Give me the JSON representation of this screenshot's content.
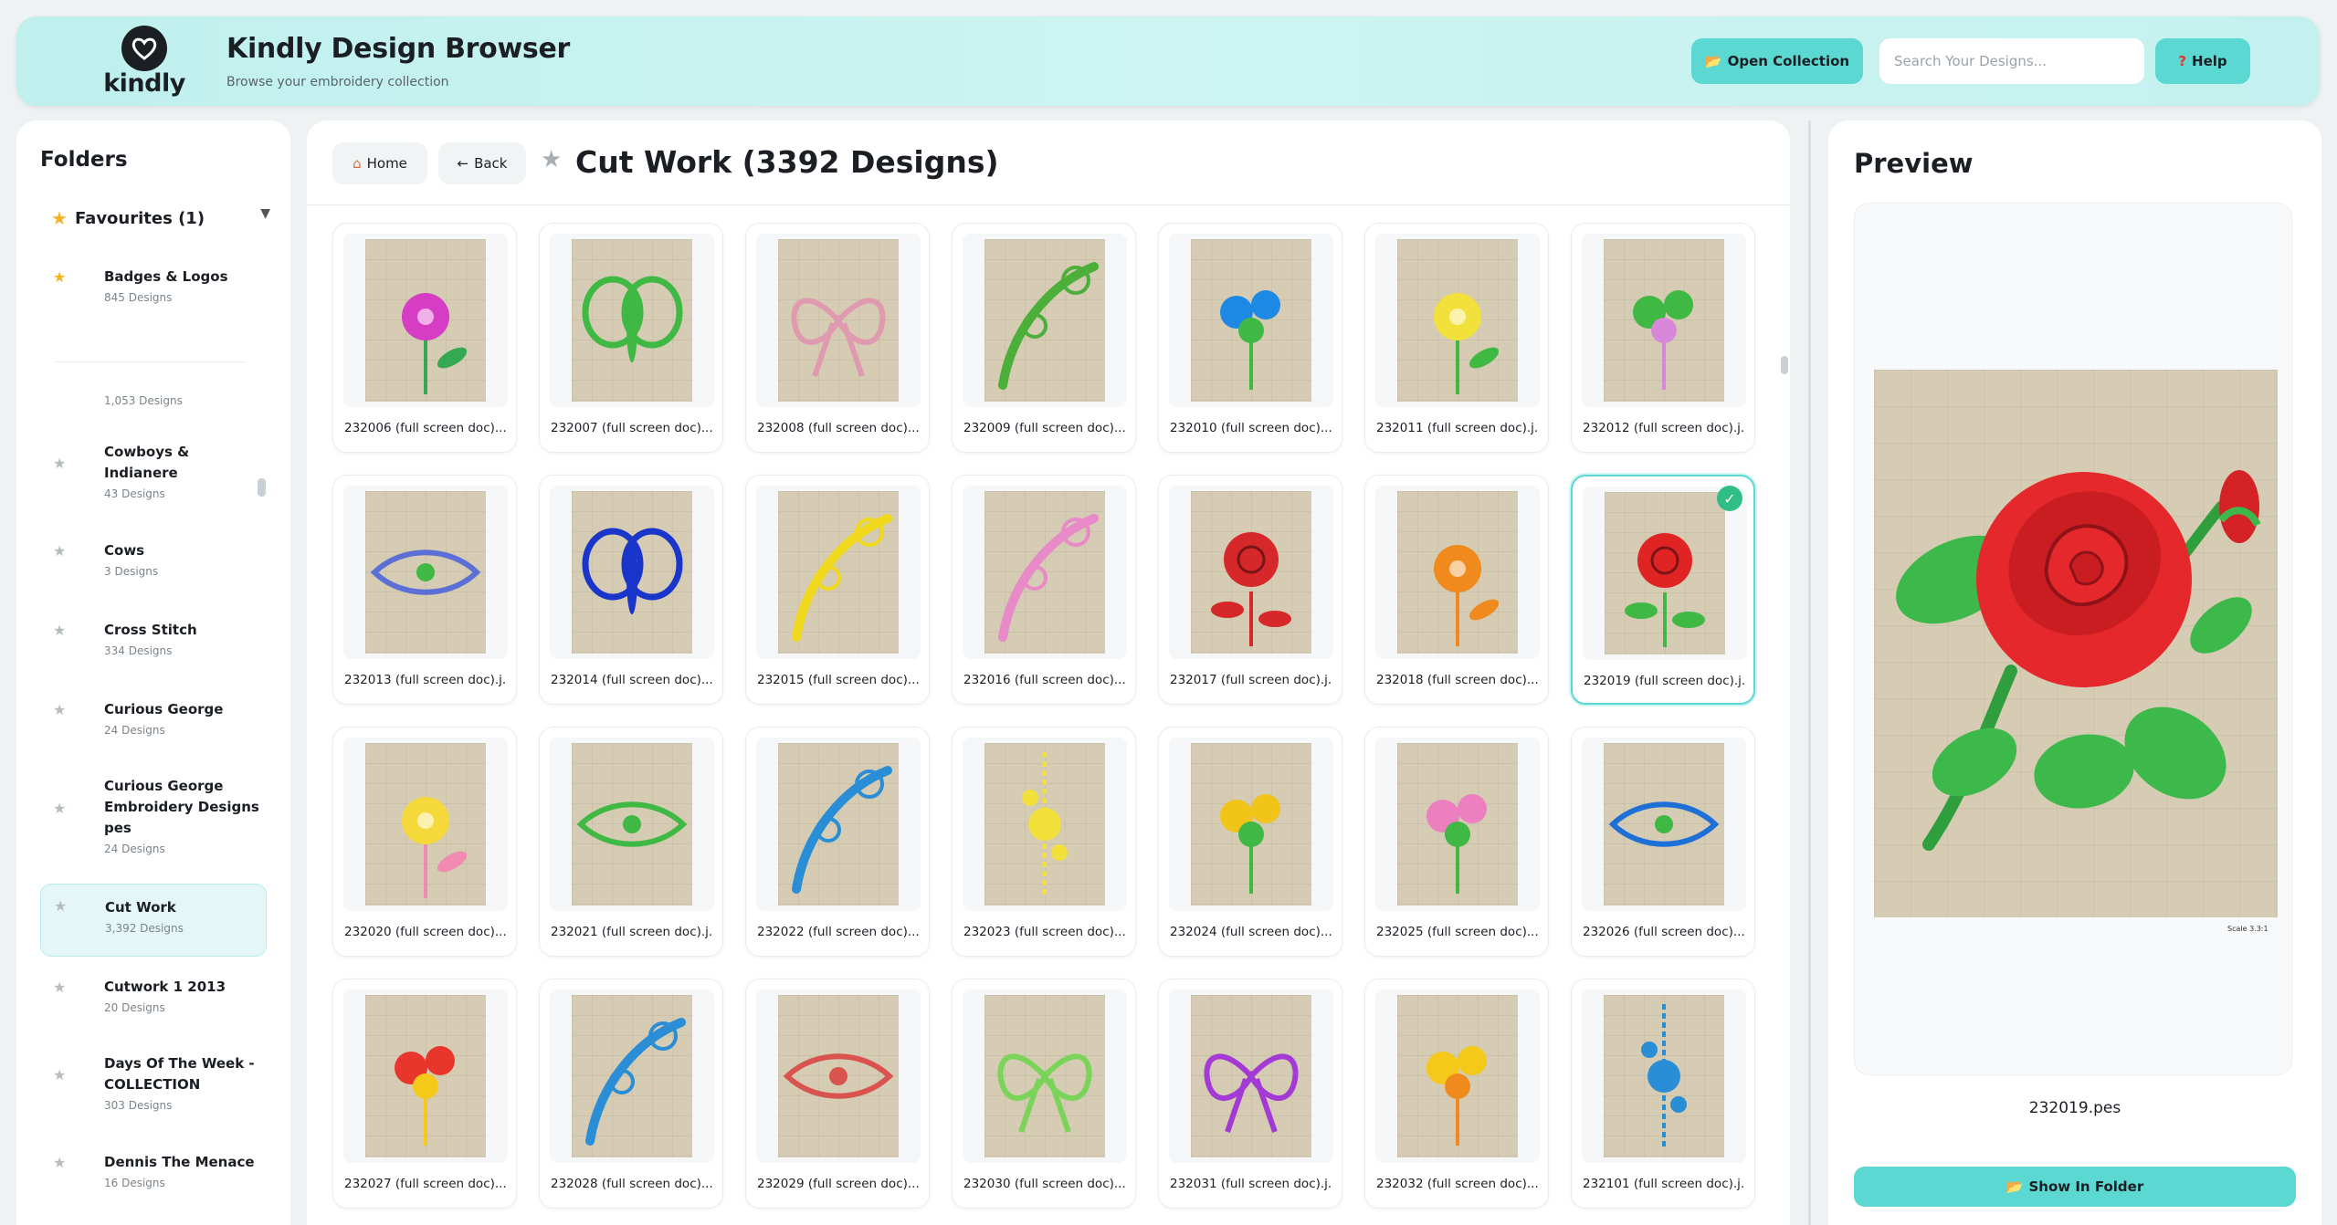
{
  "header": {
    "logo_text": "kindly",
    "title": "Kindly Design Browser",
    "subtitle": "Browse your embroidery collection",
    "open_collection_label": "Open Collection",
    "search_placeholder": "Search Your Designs...",
    "help_label": "Help"
  },
  "sidebar": {
    "title": "Folders",
    "favourites_label": "Favourites (1)",
    "items": [
      {
        "name": "Badges & Logos",
        "count": "845 Designs",
        "fav": true
      },
      {
        "name": "",
        "count": "1,053 Designs",
        "fav": false
      },
      {
        "name": "Cowboys & Indianere",
        "count": "43 Designs",
        "fav": false
      },
      {
        "name": "Cows",
        "count": "3 Designs",
        "fav": false
      },
      {
        "name": "Cross Stitch",
        "count": "334 Designs",
        "fav": false
      },
      {
        "name": "Curious George",
        "count": "24 Designs",
        "fav": false
      },
      {
        "name": "Curious George Embroidery Designs pes",
        "count": "24 Designs",
        "fav": false
      },
      {
        "name": "Cut Work",
        "count": "3,392 Designs",
        "fav": false,
        "active": true
      },
      {
        "name": "Cutwork 1 2013",
        "count": "20 Designs",
        "fav": false
      },
      {
        "name": "Days Of The Week - COLLECTION",
        "count": "303 Designs",
        "fav": false
      },
      {
        "name": "Dennis The Menace",
        "count": "16 Designs",
        "fav": false
      }
    ]
  },
  "main": {
    "home_label": "Home",
    "back_label": "Back",
    "title": "Cut Work (3392 Designs)",
    "designs": [
      {
        "label": "232006 (full screen doc)...",
        "motif": "flower-pink",
        "colors": [
          "#d63cc4",
          "#34a853"
        ]
      },
      {
        "label": "232007 (full screen doc)....",
        "motif": "dragonfly",
        "colors": [
          "#3fb844",
          "#d987d8"
        ]
      },
      {
        "label": "232008 (full screen doc)...",
        "motif": "bow-ribbon",
        "colors": [
          "#e09ab0",
          "#6ac25e"
        ]
      },
      {
        "label": "232009 (full screen doc)...",
        "motif": "swirl-green",
        "colors": [
          "#4caf3a",
          "#4caf3a"
        ]
      },
      {
        "label": "232010 (full screen doc)....",
        "motif": "blue-flowers",
        "colors": [
          "#1e88e5",
          "#3fb844"
        ]
      },
      {
        "label": "232011 (full screen doc).j...",
        "motif": "yellow-flower",
        "colors": [
          "#f2e03b",
          "#3fb844"
        ]
      },
      {
        "label": "232012 (full screen doc).j...",
        "motif": "tulips",
        "colors": [
          "#3fb844",
          "#d987d8"
        ]
      },
      {
        "label": "232013 (full screen doc).j...",
        "motif": "birds",
        "colors": [
          "#5b6fd6",
          "#3fb844"
        ]
      },
      {
        "label": "232014 (full screen doc)....",
        "motif": "blue-butterfly",
        "colors": [
          "#1a35c9",
          "#1a35c9"
        ]
      },
      {
        "label": "232015 (full screen doc)....",
        "motif": "yellow-corner",
        "colors": [
          "#f0d91c",
          "#f0d91c"
        ]
      },
      {
        "label": "232016 (full screen doc)....",
        "motif": "pink-corner",
        "colors": [
          "#e88ac8",
          "#e88ac8"
        ]
      },
      {
        "label": "232017 (full screen doc).j...",
        "motif": "red-rose-tall",
        "colors": [
          "#d6272b",
          "#d6272b"
        ]
      },
      {
        "label": "232018 (full screen doc)....",
        "motif": "orange-flower",
        "colors": [
          "#f08a1c",
          "#f08a1c"
        ]
      },
      {
        "label": "232019 (full screen doc).j...",
        "motif": "red-rose",
        "colors": [
          "#e02424",
          "#3fb844"
        ],
        "selected": true
      },
      {
        "label": "232020 (full screen doc)....",
        "motif": "yellow-pink-flower",
        "colors": [
          "#f5d93b",
          "#f08ab0"
        ]
      },
      {
        "label": "232021 (full screen doc).j...",
        "motif": "green-border",
        "colors": [
          "#3fb844",
          "#3fb844"
        ]
      },
      {
        "label": "232022 (full screen doc)....",
        "motif": "blue-corner",
        "colors": [
          "#2a8ed6",
          "#2a8ed6"
        ]
      },
      {
        "label": "232023 (full screen doc)....",
        "motif": "yellow-vertical",
        "colors": [
          "#f2e03b",
          "#f2e03b"
        ]
      },
      {
        "label": "232024 (full screen doc)....",
        "motif": "yellow-bouquet",
        "colors": [
          "#f0c419",
          "#3fb844"
        ]
      },
      {
        "label": "232025 (full screen doc)....",
        "motif": "pink-lilies",
        "colors": [
          "#ec7fc0",
          "#3fb844"
        ]
      },
      {
        "label": "232026 (full screen doc)....",
        "motif": "blue-garland",
        "colors": [
          "#1e6fd6",
          "#3fb844"
        ]
      },
      {
        "label": "232027 (full screen doc)....",
        "motif": "red-yellow-flowers",
        "colors": [
          "#e8362c",
          "#f5c919"
        ]
      },
      {
        "label": "232028 (full screen doc)....",
        "motif": "blue-lattice",
        "colors": [
          "#2a8ed6",
          "#2a8ed6"
        ]
      },
      {
        "label": "232029 (full screen doc)....",
        "motif": "red-border",
        "colors": [
          "#d9534f",
          "#d9534f"
        ]
      },
      {
        "label": "232030 (full screen doc)....",
        "motif": "green-bow",
        "colors": [
          "#7bd45a",
          "#7bd45a"
        ]
      },
      {
        "label": "232031 (full screen doc).j...",
        "motif": "purple-bow",
        "colors": [
          "#a43ad6",
          "#a43ad6"
        ]
      },
      {
        "label": "232032 (full screen doc)....",
        "motif": "yellow-orange-bouquet",
        "colors": [
          "#f5c919",
          "#f08a1c"
        ]
      },
      {
        "label": "232101 (full screen doc).j...",
        "motif": "hanging-flowers",
        "colors": [
          "#2a8ed6",
          "#3fb844"
        ]
      }
    ]
  },
  "preview": {
    "title": "Preview",
    "filename": "232019.pes",
    "scale_text": "Scale 3.3:1",
    "show_in_folder_label": "Show In Folder"
  },
  "colors": {
    "accent": "#5cd8d3",
    "header_bg": "#c4f1ef",
    "fabric": "#d5ccb3",
    "star_gold": "#f5b41f",
    "check_green": "#2fbf86"
  }
}
